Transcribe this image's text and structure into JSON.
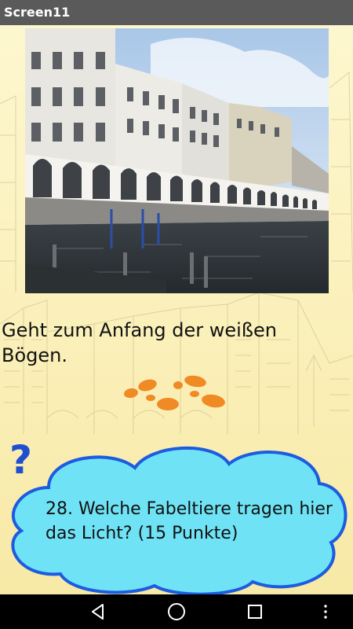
{
  "app": {
    "title": "Screen11"
  },
  "main": {
    "instruction": "Geht zum Anfang der weißen Bögen.",
    "question": "28. Welche Fabeltiere tragen hier das Licht? (15 Punkte)",
    "question_mark": "?"
  },
  "colors": {
    "titlebar": "#5a5a5a",
    "background": "#fdf6c8",
    "cloud_fill": "#6fe3f5",
    "cloud_stroke": "#1d5be0",
    "footprints": "#f08a24"
  },
  "nav": {
    "icons": [
      "back-icon",
      "home-icon",
      "recents-icon",
      "more-icon"
    ]
  }
}
